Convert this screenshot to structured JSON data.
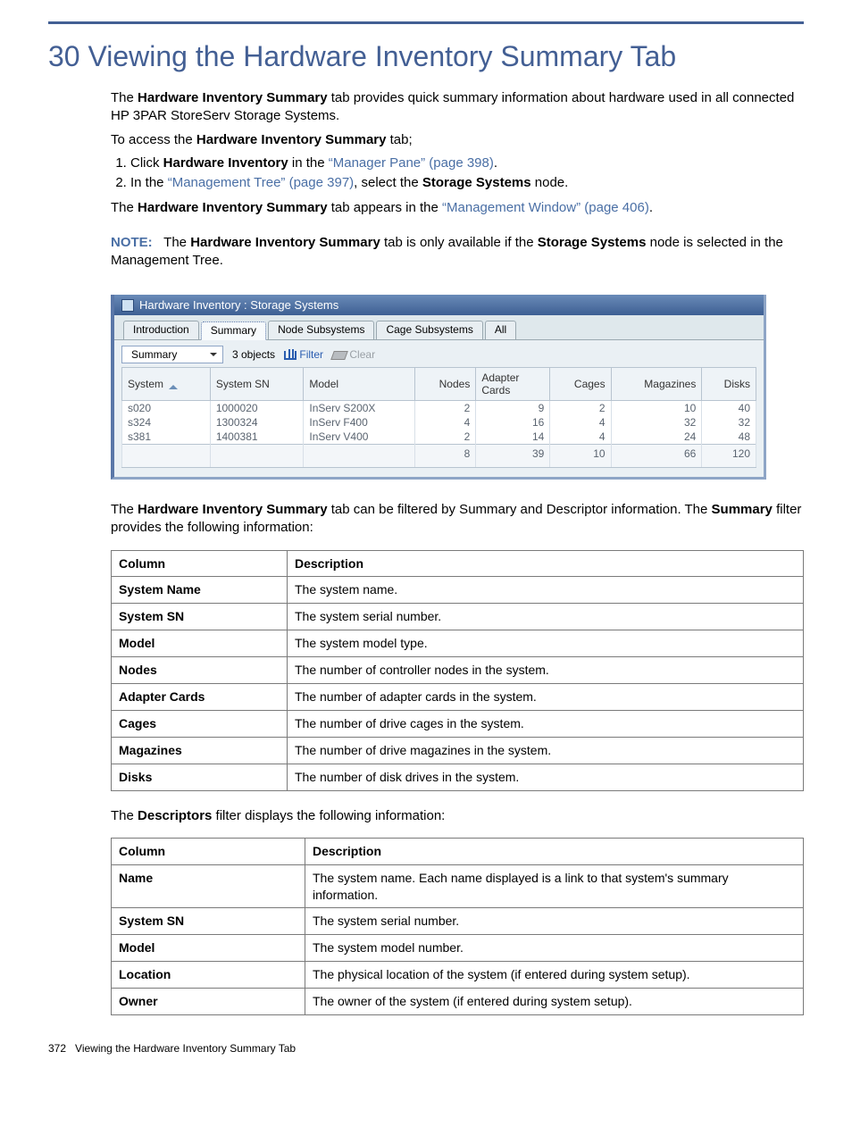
{
  "title": "30 Viewing the Hardware Inventory Summary Tab",
  "intro": {
    "p1_prefix": "The ",
    "p1_bold": "Hardware Inventory Summary",
    "p1_suffix": " tab provides quick summary information about hardware used in all connected HP 3PAR StoreServ Storage Systems.",
    "p2_prefix": "To access the ",
    "p2_bold": "Hardware Inventory Summary",
    "p2_suffix": " tab;",
    "step1_prefix": "Click ",
    "step1_bold": "Hardware Inventory",
    "step1_mid": " in the ",
    "step1_link": "“Manager Pane” (page 398)",
    "step1_end": ".",
    "step2_prefix": "In the ",
    "step2_link": "“Management Tree” (page 397)",
    "step2_mid": ", select the ",
    "step2_bold": "Storage Systems",
    "step2_end": " node.",
    "p3_prefix": "The ",
    "p3_bold": "Hardware Inventory Summary",
    "p3_mid": " tab appears in the ",
    "p3_link": "“Management Window” (page 406)",
    "p3_end": ".",
    "note_label": "NOTE:",
    "note_prefix": "   The ",
    "note_bold1": "Hardware Inventory Summary",
    "note_mid": " tab is only available if the ",
    "note_bold2": "Storage Systems",
    "note_end": " node is selected in the Management Tree."
  },
  "screenshot": {
    "title": "Hardware Inventory : Storage Systems",
    "tabs": [
      "Introduction",
      "Summary",
      "Node Subsystems",
      "Cage Subsystems",
      "All"
    ],
    "active_tab": "Summary",
    "dropdown": "Summary",
    "objects": "3 objects",
    "filter": "Filter",
    "clear": "Clear",
    "headers": [
      "System",
      "System SN",
      "Model",
      "Nodes",
      "Adapter Cards",
      "Cages",
      "Magazines",
      "Disks"
    ],
    "rows": [
      {
        "system": "s020",
        "sn": "1000020",
        "model": "InServ S200X",
        "nodes": "2",
        "adapter": "9",
        "cages": "2",
        "mag": "10",
        "disks": "40"
      },
      {
        "system": "s324",
        "sn": "1300324",
        "model": "InServ F400",
        "nodes": "4",
        "adapter": "16",
        "cages": "4",
        "mag": "32",
        "disks": "32"
      },
      {
        "system": "s381",
        "sn": "1400381",
        "model": "InServ V400",
        "nodes": "2",
        "adapter": "14",
        "cages": "4",
        "mag": "24",
        "disks": "48"
      }
    ],
    "totals": {
      "nodes": "8",
      "adapter": "39",
      "cages": "10",
      "mag": "66",
      "disks": "120"
    }
  },
  "after_fig": {
    "p1_prefix": "The ",
    "p1_bold": "Hardware Inventory Summary",
    "p1_suffix": " tab can be filtered by Summary and Descriptor information. The ",
    "p1_bold2": "Summary",
    "p1_end": " filter provides the following information:"
  },
  "table1": {
    "h1": "Column",
    "h2": "Description",
    "rows": [
      {
        "c": "System Name",
        "d": "The system name."
      },
      {
        "c": "System SN",
        "d": "The system serial number."
      },
      {
        "c": "Model",
        "d": "The system model type."
      },
      {
        "c": "Nodes",
        "d": "The number of controller nodes in the system."
      },
      {
        "c": "Adapter Cards",
        "d": "The number of adapter cards in the system."
      },
      {
        "c": "Cages",
        "d": "The number of drive cages in the system."
      },
      {
        "c": "Magazines",
        "d": "The number of drive magazines in the system."
      },
      {
        "c": "Disks",
        "d": "The number of disk drives in the system."
      }
    ]
  },
  "between": {
    "prefix": "The ",
    "bold": "Descriptors",
    "suffix": " filter displays the following information:"
  },
  "table2": {
    "h1": "Column",
    "h2": "Description",
    "rows": [
      {
        "c": "Name",
        "d": "The system name. Each name displayed is a link to that system's summary information."
      },
      {
        "c": "System SN",
        "d": "The system serial number."
      },
      {
        "c": "Model",
        "d": "The system model number."
      },
      {
        "c": "Location",
        "d": "The physical location of the system (if entered during system setup)."
      },
      {
        "c": "Owner",
        "d": "The owner of the system (if entered during system setup)."
      }
    ]
  },
  "footer": {
    "page": "372",
    "label": "Viewing the Hardware Inventory Summary Tab"
  }
}
